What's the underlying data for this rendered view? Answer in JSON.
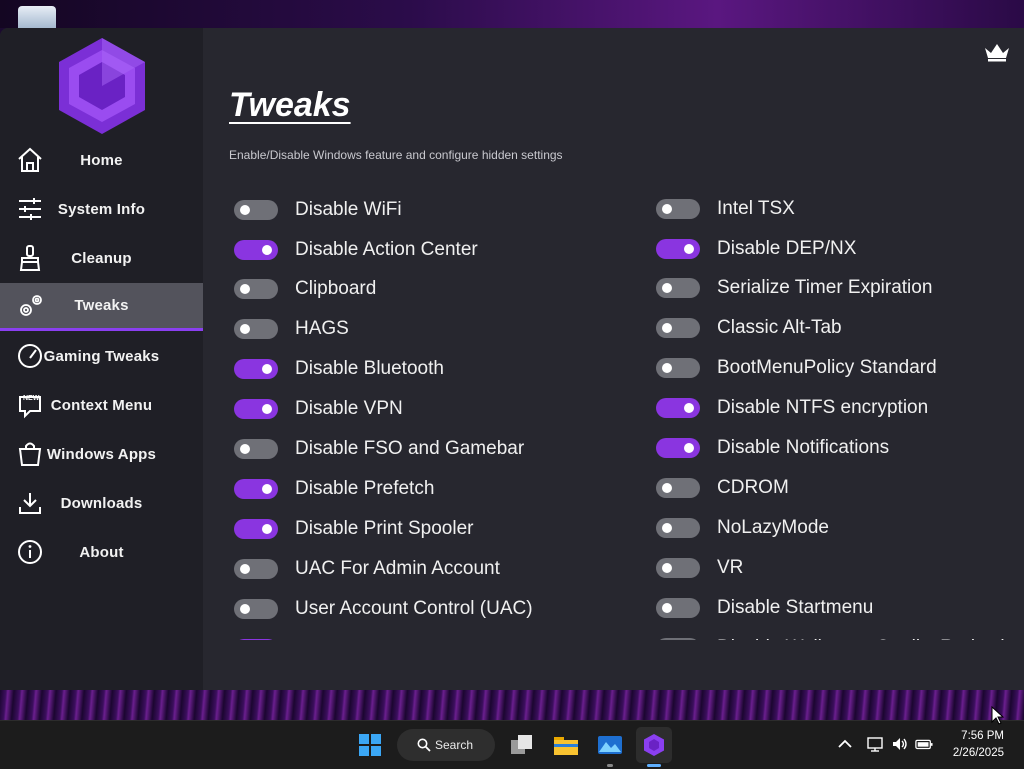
{
  "app": {
    "title": "Tweaks",
    "subtitle": "Enable/Disable Windows feature and configure hidden settings",
    "accent": "#8a35e0"
  },
  "sidebar": {
    "items": [
      {
        "label": "Home",
        "icon": "home-icon"
      },
      {
        "label": "System Info",
        "icon": "sliders-icon"
      },
      {
        "label": "Cleanup",
        "icon": "brush-icon"
      },
      {
        "label": "Tweaks",
        "icon": "gears-icon",
        "active": true
      },
      {
        "label": "Gaming Tweaks",
        "icon": "gauge-icon"
      },
      {
        "label": "Context Menu",
        "icon": "new-badge-icon"
      },
      {
        "label": "Windows Apps",
        "icon": "bag-icon"
      },
      {
        "label": "Downloads",
        "icon": "download-icon"
      },
      {
        "label": "About",
        "icon": "info-icon"
      }
    ]
  },
  "tweaks": {
    "left": [
      {
        "label": "Disable WiFi",
        "on": false
      },
      {
        "label": "Disable Action Center",
        "on": true
      },
      {
        "label": "Clipboard",
        "on": false
      },
      {
        "label": "HAGS",
        "on": false
      },
      {
        "label": "Disable Bluetooth",
        "on": true
      },
      {
        "label": "Disable VPN",
        "on": true
      },
      {
        "label": "Disable FSO and Gamebar",
        "on": false
      },
      {
        "label": "Disable Prefetch",
        "on": true
      },
      {
        "label": "Disable Print Spooler",
        "on": true
      },
      {
        "label": "UAC For Admin Account",
        "on": false
      },
      {
        "label": "User Account Control (UAC)",
        "on": false
      },
      {
        "label": "Disable Hyper-V and VBS",
        "on": true
      }
    ],
    "right": [
      {
        "label": "Intel TSX",
        "on": false
      },
      {
        "label": "Disable DEP/NX",
        "on": true
      },
      {
        "label": "Serialize Timer Expiration",
        "on": false
      },
      {
        "label": "Classic Alt-Tab",
        "on": false
      },
      {
        "label": "BootMenuPolicy Standard",
        "on": false
      },
      {
        "label": "Disable NTFS encryption",
        "on": true
      },
      {
        "label": "Disable Notifications",
        "on": true
      },
      {
        "label": "CDROM",
        "on": false
      },
      {
        "label": "NoLazyMode",
        "on": false
      },
      {
        "label": "VR",
        "on": false
      },
      {
        "label": "Disable Startmenu",
        "on": false
      },
      {
        "label": "Disable Wallpaper Quality Reduction",
        "on": false
      }
    ]
  },
  "taskbar": {
    "search_label": "Search",
    "time": "7:56 PM",
    "date": "2/26/2025"
  }
}
